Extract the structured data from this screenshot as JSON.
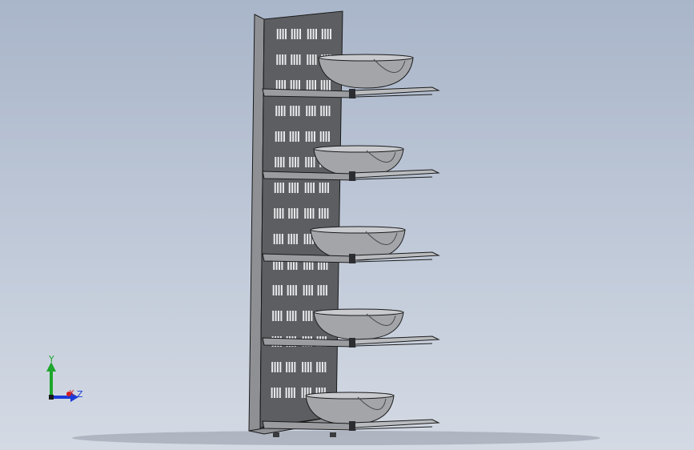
{
  "viewport": {
    "background_top": "#a9b5c9",
    "background_bottom": "#d4dae4"
  },
  "model": {
    "part_color": "#8b8d91",
    "edge_color": "#1a1a1a",
    "bowl_color": "#9d9fa2",
    "panel_color": "#5a5c60",
    "shelf_count": 5
  },
  "triad": {
    "y_label": "Y",
    "x_label": "X",
    "z_label": "Z",
    "y_color": "#1fa62c",
    "x_color": "#d81d1d",
    "z_color": "#1b3bd8"
  }
}
